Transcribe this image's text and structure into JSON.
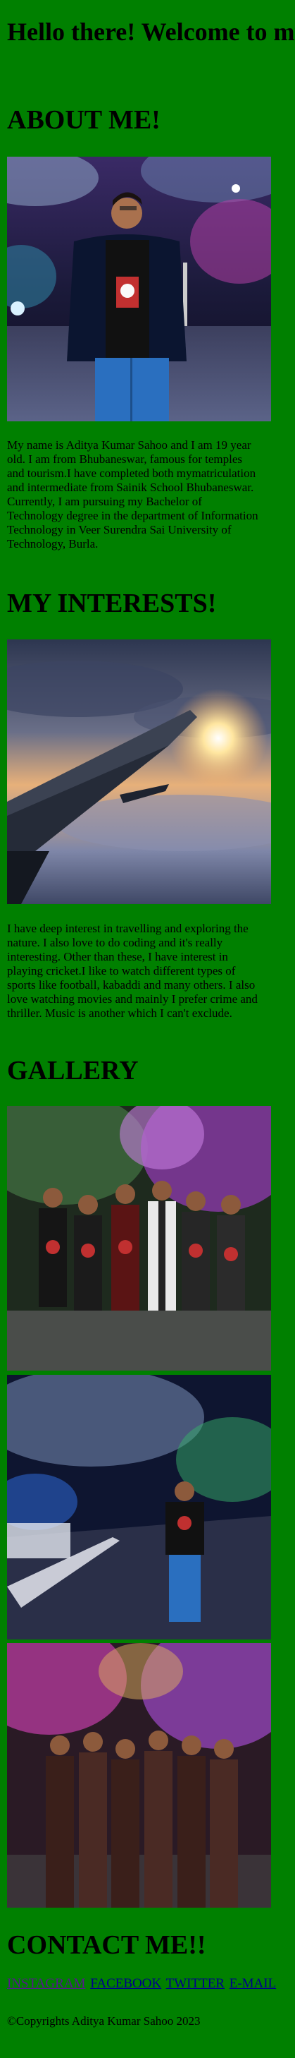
{
  "header": {
    "title": "Hello there! Welcome to my page."
  },
  "about": {
    "heading": "ABOUT ME!",
    "lines": [
      "My name is Aditya Kumar Sahoo and I am 19 year",
      "old. I am from Bhubaneswar, famous for temples",
      "and tourism.I have completed both mymatriculation",
      "and intermediate from Sainik School Bhubaneswar.",
      "Currently, I am pursuing my Bachelor of",
      "Technology degree in the department of Information",
      "Technology in Veer Surendra Sai University of",
      "Technology, Burla."
    ]
  },
  "interests": {
    "heading": "MY INTERESTS!",
    "lines": [
      "I have deep interest in travelling and exploring the",
      "nature. I also love to do coding and it's really",
      "interesting. Other than these, I have interest in",
      "playing cricket.I like to watch different types of",
      "sports like football, kabaddi and many others. I also",
      "love watching movies and mainly I prefer crime and",
      "thriller. Music is another which I can't exclude."
    ]
  },
  "gallery": {
    "heading": "GALLERY"
  },
  "contact": {
    "heading": "CONTACT ME!!",
    "links": [
      "INSTAGRAM",
      "FACEBOOK",
      "TWITTER",
      "E-MAIL"
    ]
  },
  "footer": {
    "copyright": "©Copyrights Aditya Kumar Sahoo 2023"
  },
  "colors": {
    "background": "#008000",
    "link": "#00008b",
    "visited_link": "#551a8b"
  }
}
